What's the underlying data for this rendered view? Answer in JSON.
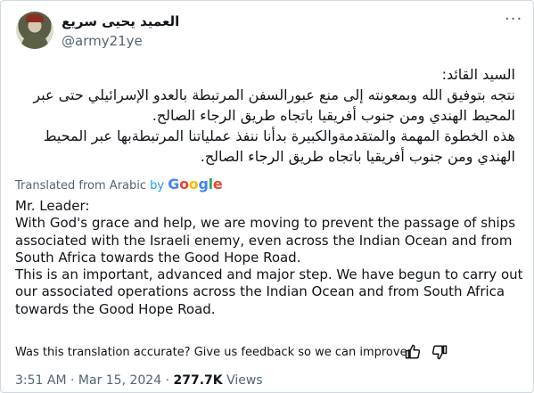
{
  "author": {
    "name": "العميد يحيى سريع",
    "handle": "@army21ye"
  },
  "arabic_text": "السيد القائد:\nنتجه بتوفيق الله وبمعونته إلى منع عبورالسفن المرتبطة بالعدو الإسرائيلي حتى عبر المحيط الهندي ومن جنوب أفريقيا باتجاه طريق الرجاء الصالح.\nهذه الخطوة المهمة والمتقدمةوالكبيرة بدأنا ننفذ عملياتنا المرتبطةبها عبر المحيط الهندي ومن جنوب أفريقيا باتجاه طريق الرجاء الصالح.",
  "translation": {
    "label": "Translated from Arabic",
    "by": "by",
    "provider": [
      "G",
      "o",
      "o",
      "g",
      "l",
      "e"
    ],
    "text": "Mr. Leader:\nWith God's grace and help, we are moving to prevent the passage of ships associated with the Israeli enemy, even across the Indian Ocean and from South Africa towards the Good Hope Road.\nThis is an important, advanced and major step. We have begun to carry out our associated operations across the Indian Ocean and from South Africa towards the Good Hope Road."
  },
  "feedback": {
    "prompt": "Was this translation accurate? Give us feedback so we can improve:",
    "icons": [
      "thumbs-up-icon",
      "thumbs-down-icon"
    ]
  },
  "meta": {
    "time": "3:51 AM",
    "sep1": " · ",
    "date": "Mar 15, 2024",
    "sep2": " · ",
    "views": "277.7K",
    "views_label": " Views"
  },
  "more_icon": "more-icon"
}
